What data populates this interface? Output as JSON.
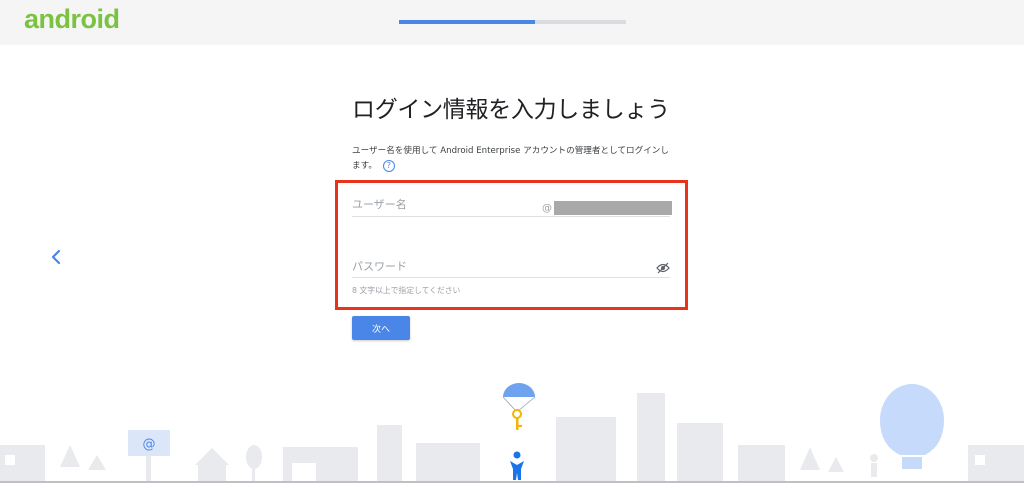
{
  "header": {
    "logo_text": "android",
    "progress_fraction": 0.6
  },
  "main": {
    "title": "ログイン情報を入力しましょう",
    "subtitle": "ユーザー名を使用して Android Enterprise アカウントの管理者としてログインします。",
    "help_icon_glyph": "?",
    "username": {
      "placeholder": "ユーザー名",
      "value": "",
      "domain_prefix": "@"
    },
    "password": {
      "placeholder": "パスワード",
      "value": "",
      "hint": "8 文字以上で指定してください"
    },
    "next_label": "次へ"
  },
  "scenery": {
    "billboard_glyph": "@"
  },
  "colors": {
    "accent": "#4a86e8",
    "logo_green": "#7cc242",
    "highlight_red": "#e8331a",
    "city_gray": "#e8eaed",
    "sky_blue": "#c6dafc"
  },
  "icons": {
    "back": "chevron-left-icon",
    "help": "help-circle-icon",
    "toggle_password": "eye-off-icon"
  }
}
